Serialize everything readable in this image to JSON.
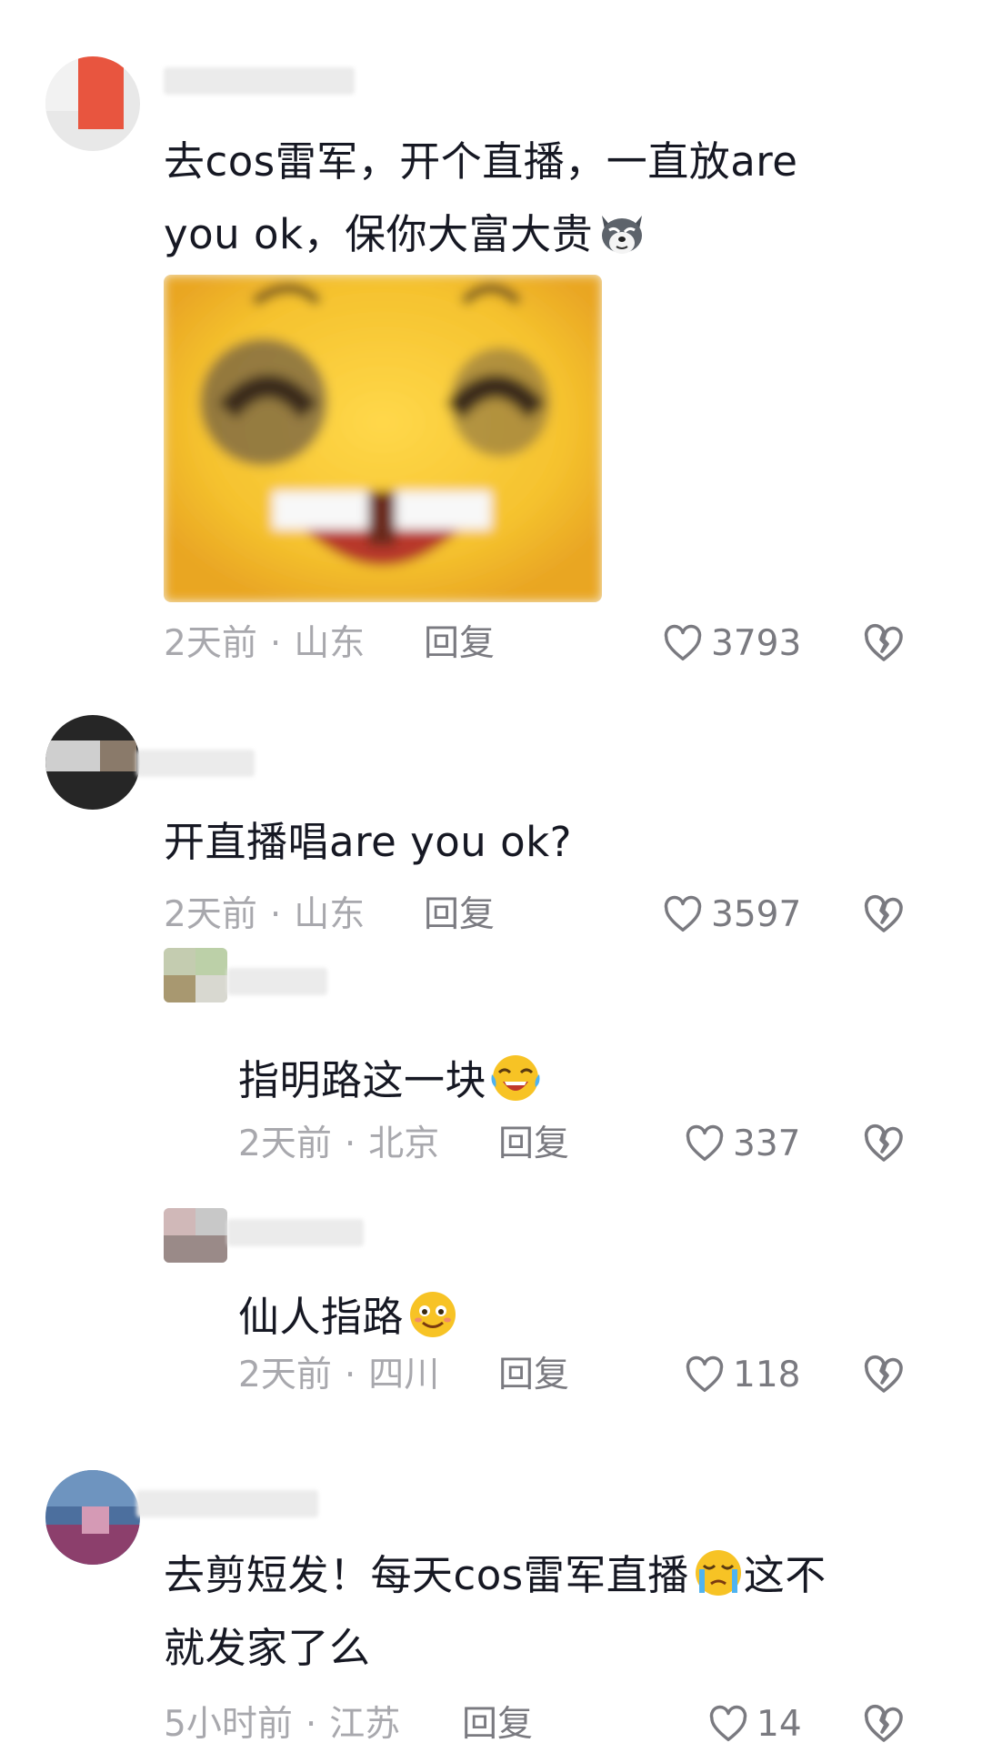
{
  "comments": [
    {
      "text_line1": "去cos雷军，开个直播，一直放are",
      "text_line2": "you ok，保你大富大贵",
      "emoji": "husky-doge-emoji",
      "sticker": "blurry-laughing-emoji-sticker",
      "time": "2天前",
      "location": "山东",
      "reply_label": "回复",
      "likes": "3793"
    },
    {
      "text": "开直播唱are you ok?",
      "time": "2天前",
      "location": "山东",
      "reply_label": "回复",
      "likes": "3597"
    },
    {
      "text": "指明路这一块",
      "emoji": "laughing-tears-emoji",
      "time": "2天前",
      "location": "北京",
      "reply_label": "回复",
      "likes": "337"
    },
    {
      "text": "仙人指路",
      "emoji": "smile-emoji",
      "time": "2天前",
      "location": "四川",
      "reply_label": "回复",
      "likes": "118"
    },
    {
      "text_line1": "去剪短发！每天cos雷军直播",
      "text_line1_after": "这不",
      "text_line2": "就发家了么",
      "emoji": "crying-emoji",
      "time": "5小时前",
      "location": "江苏",
      "reply_label": "回复",
      "likes": "14"
    }
  ],
  "meta_separator": "·",
  "icons": {
    "like": "heart-outline-icon",
    "dislike": "broken-heart-icon"
  },
  "colors": {
    "text": "#161823",
    "meta": "#a8a8ad",
    "reply": "#7a7a80"
  }
}
